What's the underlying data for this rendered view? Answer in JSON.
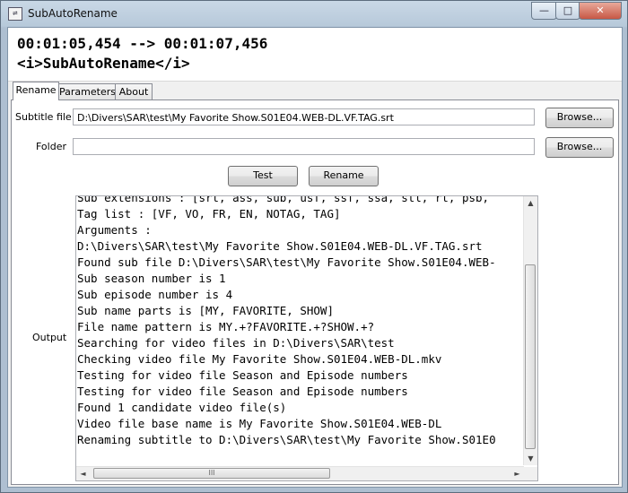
{
  "window": {
    "title": "SubAutoRename",
    "icon": "app-icon",
    "controls": {
      "minimize": "—",
      "maximize": "□",
      "close": "✕"
    }
  },
  "header": {
    "line1": "00:01:05,454 --> 00:01:07,456",
    "line2": "<i>SubAutoRename</i>"
  },
  "tabs": [
    {
      "label": "Rename",
      "active": true
    },
    {
      "label": "Parameters",
      "active": false
    },
    {
      "label": "About",
      "active": false
    }
  ],
  "rename": {
    "subtitle_label": "Subtitle file",
    "subtitle_value": "D:\\Divers\\SAR\\test\\My Favorite Show.S01E04.WEB-DL.VF.TAG.srt",
    "folder_label": "Folder",
    "folder_value": "",
    "browse_label": "Browse...",
    "test_label": "Test",
    "rename_label": "Rename",
    "output_label": "Output",
    "output_lines": [
      "Sub extensions : [srt, ass, sub, usf, ssf, ssa, stl, rt, psb,",
      "Tag list : [VF, VO, FR, EN, NOTAG, TAG]",
      "Arguments :",
      "D:\\Divers\\SAR\\test\\My Favorite Show.S01E04.WEB-DL.VF.TAG.srt",
      "Found sub file D:\\Divers\\SAR\\test\\My Favorite Show.S01E04.WEB-",
      "Sub season number is 1",
      "Sub episode number is 4",
      "Sub name parts is [MY, FAVORITE, SHOW]",
      "File name pattern is MY.+?FAVORITE.+?SHOW.+?",
      "Searching for video files in D:\\Divers\\SAR\\test",
      "Checking video file My Favorite Show.S01E04.WEB-DL.mkv",
      "Testing for video file Season and Episode numbers",
      "Testing for video file Season and Episode numbers",
      "Found 1 candidate video file(s)",
      "Video file base name is My Favorite Show.S01E04.WEB-DL",
      "Renaming subtitle to D:\\Divers\\SAR\\test\\My Favorite Show.S01E0"
    ],
    "scrollbar": {
      "up": "▲",
      "down": "▼",
      "left": "◄",
      "right": "►",
      "grip": "III"
    }
  }
}
